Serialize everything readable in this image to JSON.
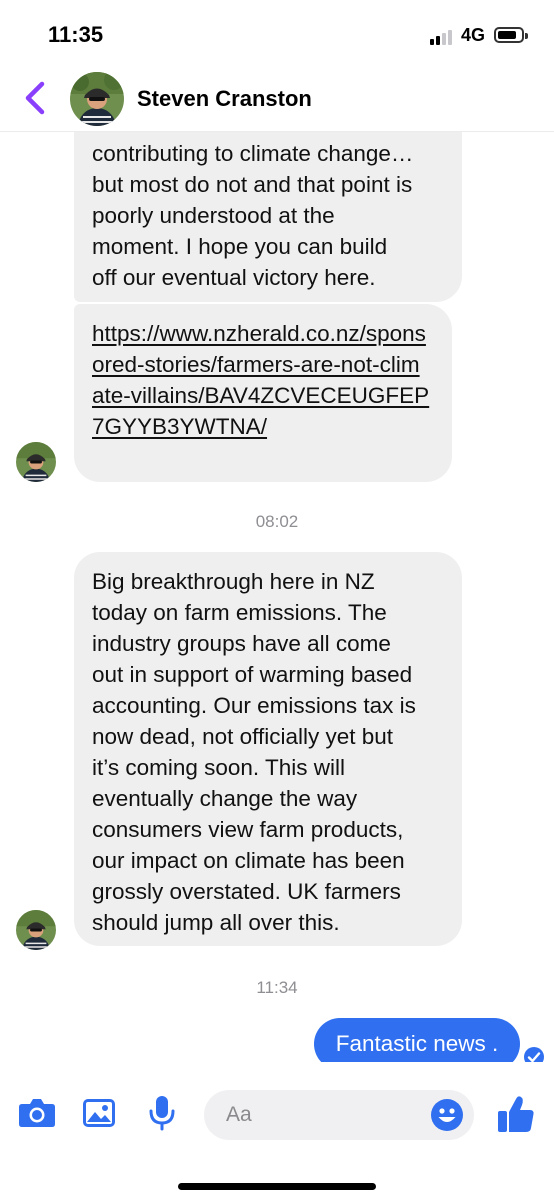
{
  "status_bar": {
    "time": "11:35",
    "network": "4G"
  },
  "header": {
    "contact_name": "Steven Cranston",
    "back_icon": "chevron-left-icon",
    "accent_color": "#8a3ffc"
  },
  "messages": [
    {
      "sender": "contact",
      "text": "contributing to climate change…\nbut most do not and that point is\npoorly understood at the\nmoment. I hope you can build\noff our eventual victory here."
    },
    {
      "sender": "contact",
      "link": "https://www.nzherald.co.nz/sponsored-stories/farmers-are-not-climate-villains/BAV4ZCVECEUGFEP7GYYB3YWTNA/"
    },
    {
      "timestamp": "08:02"
    },
    {
      "sender": "contact",
      "text": "Big breakthrough here in NZ\ntoday on farm emissions. The\nindustry groups have all come\nout in support of warming based\naccounting. Our emissions tax is\nnow dead, not officially yet but\nit’s coming soon. This will\neventually change the way\nconsumers view farm products,\nour impact on climate has been\ngrossly overstated. UK farmers\nshould jump all over this."
    },
    {
      "timestamp": "11:34"
    },
    {
      "sender": "me",
      "text": "Fantastic news ."
    }
  ],
  "composer": {
    "placeholder": "Aa",
    "icons": [
      "camera-icon",
      "image-icon",
      "microphone-icon",
      "emoji-icon",
      "thumbs-up-icon"
    ],
    "accent_color": "#2f6ff0"
  },
  "colors": {
    "received_bubble": "#efefef",
    "sent_bubble": "#2f6ff0",
    "timestamp": "#8e8e93"
  }
}
